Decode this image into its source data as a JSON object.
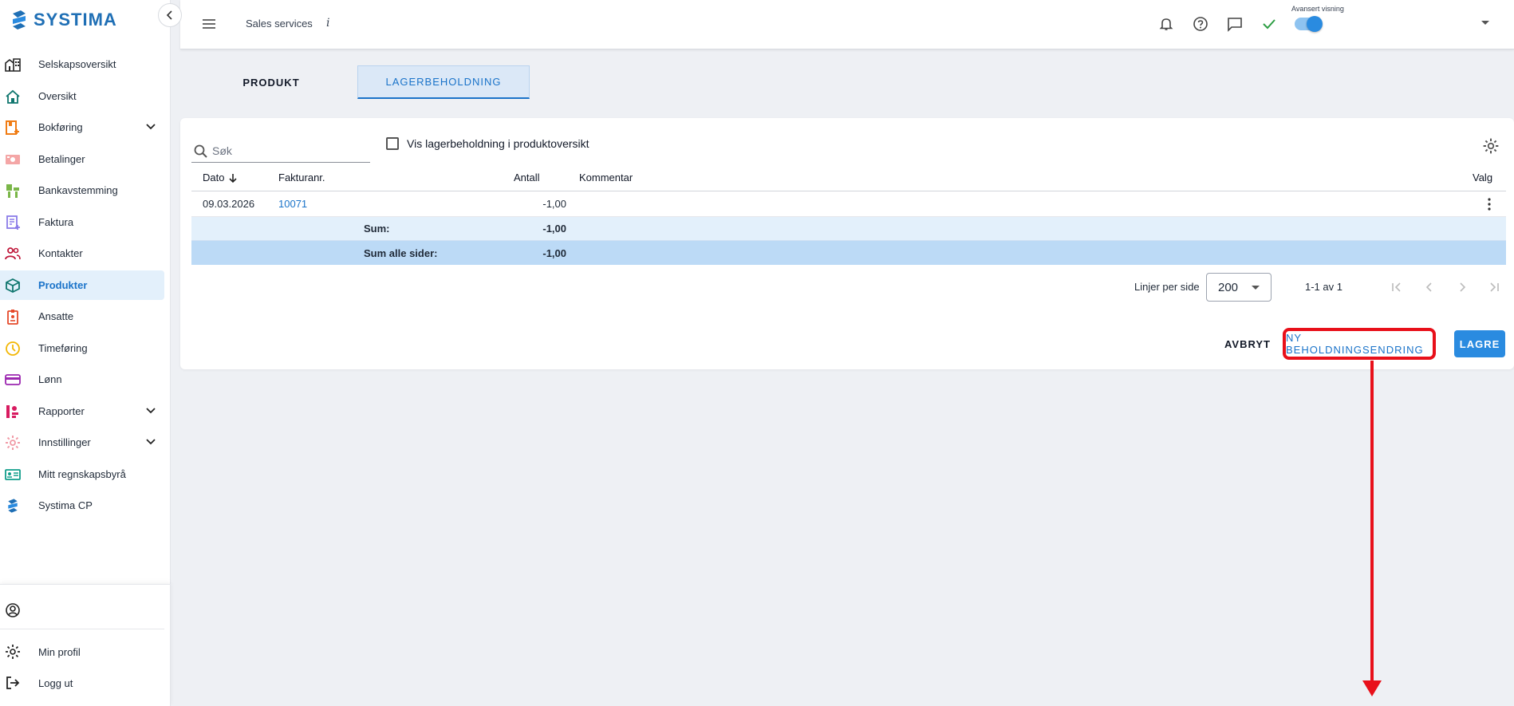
{
  "brand": {
    "logo_text": "SYSTIMA",
    "accent": "#1a73c9",
    "highlight": "#e8101a"
  },
  "sidebar": {
    "items": [
      {
        "label": "Selskapsoversikt",
        "icon": "building-icon"
      },
      {
        "label": "Oversikt",
        "icon": "home-icon"
      },
      {
        "label": "Bokføring",
        "icon": "ledger-icon",
        "expandable": true
      },
      {
        "label": "Betalinger",
        "icon": "money-icon"
      },
      {
        "label": "Bankavstemming",
        "icon": "bank-icon"
      },
      {
        "label": "Faktura",
        "icon": "invoice-icon"
      },
      {
        "label": "Kontakter",
        "icon": "people-icon"
      },
      {
        "label": "Produkter",
        "icon": "box-icon",
        "active": true
      },
      {
        "label": "Ansatte",
        "icon": "badge-icon"
      },
      {
        "label": "Timeføring",
        "icon": "clock-icon"
      },
      {
        "label": "Lønn",
        "icon": "card-icon"
      },
      {
        "label": "Rapporter",
        "icon": "chart-icon",
        "expandable": true
      },
      {
        "label": "Innstillinger",
        "icon": "gear-icon",
        "expandable": true
      },
      {
        "label": "Mitt regnskapsbyrå",
        "icon": "id-card-icon"
      },
      {
        "label": "Systima CP",
        "icon": "systima-icon"
      }
    ],
    "bottom": {
      "profile": "Min profil",
      "logout": "Logg ut"
    }
  },
  "topbar": {
    "company": "Sales services",
    "info": "i",
    "advanced_label": "Avansert visning"
  },
  "tabs": {
    "produkt": "PRODUKT",
    "lager": "LAGERBEHOLDNING"
  },
  "search": {
    "placeholder": "Søk"
  },
  "checkbox_label": "Vis lagerbeholdning i produktoversikt",
  "table": {
    "headers": {
      "dato": "Dato",
      "faktura": "Fakturanr.",
      "antall": "Antall",
      "kommentar": "Kommentar",
      "valg": "Valg"
    },
    "rows": [
      {
        "dato": "09.03.2026",
        "faktura": "10071",
        "antall": "-1,00",
        "kommentar": ""
      }
    ],
    "sum_label": "Sum:",
    "sum_value": "-1,00",
    "sum_all_label": "Sum alle sider:",
    "sum_all_value": "-1,00"
  },
  "pager": {
    "label": "Linjer per side",
    "value": "200",
    "range": "1-1 av 1"
  },
  "actions": {
    "cancel": "AVBRYT",
    "new": "NY BEHOLDNINGSENDRING",
    "save": "LAGRE"
  }
}
